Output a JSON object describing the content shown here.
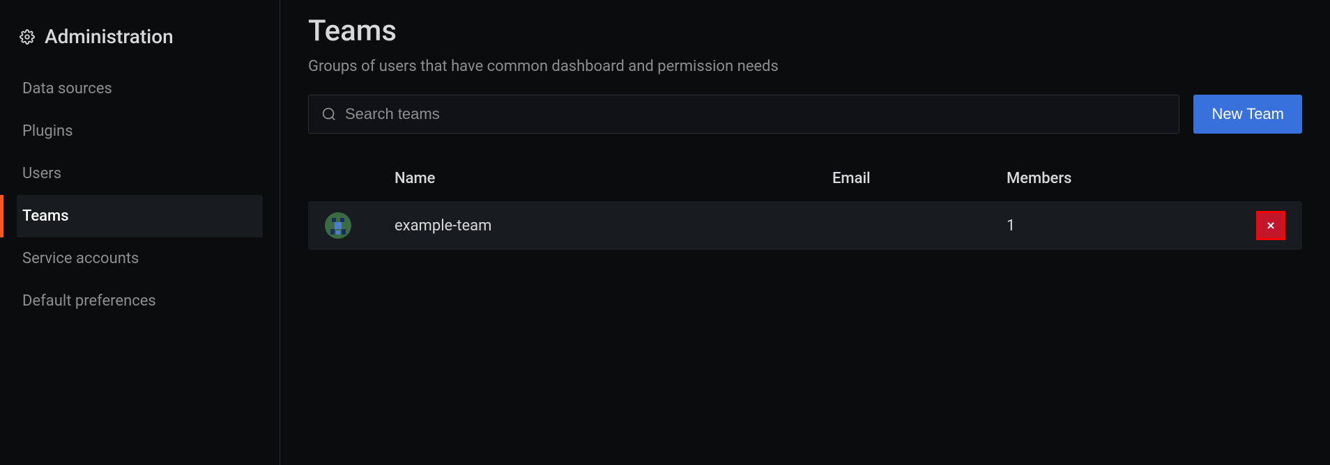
{
  "sidebar": {
    "title": "Administration",
    "items": [
      {
        "label": "Data sources"
      },
      {
        "label": "Plugins"
      },
      {
        "label": "Users"
      },
      {
        "label": "Teams"
      },
      {
        "label": "Service accounts"
      },
      {
        "label": "Default preferences"
      }
    ]
  },
  "page": {
    "title": "Teams",
    "subtitle": "Groups of users that have common dashboard and permission needs"
  },
  "search": {
    "placeholder": "Search teams"
  },
  "toolbar": {
    "new_team_label": "New Team"
  },
  "table": {
    "headers": {
      "name": "Name",
      "email": "Email",
      "members": "Members"
    },
    "rows": [
      {
        "name": "example-team",
        "email": "",
        "members": "1"
      }
    ]
  }
}
